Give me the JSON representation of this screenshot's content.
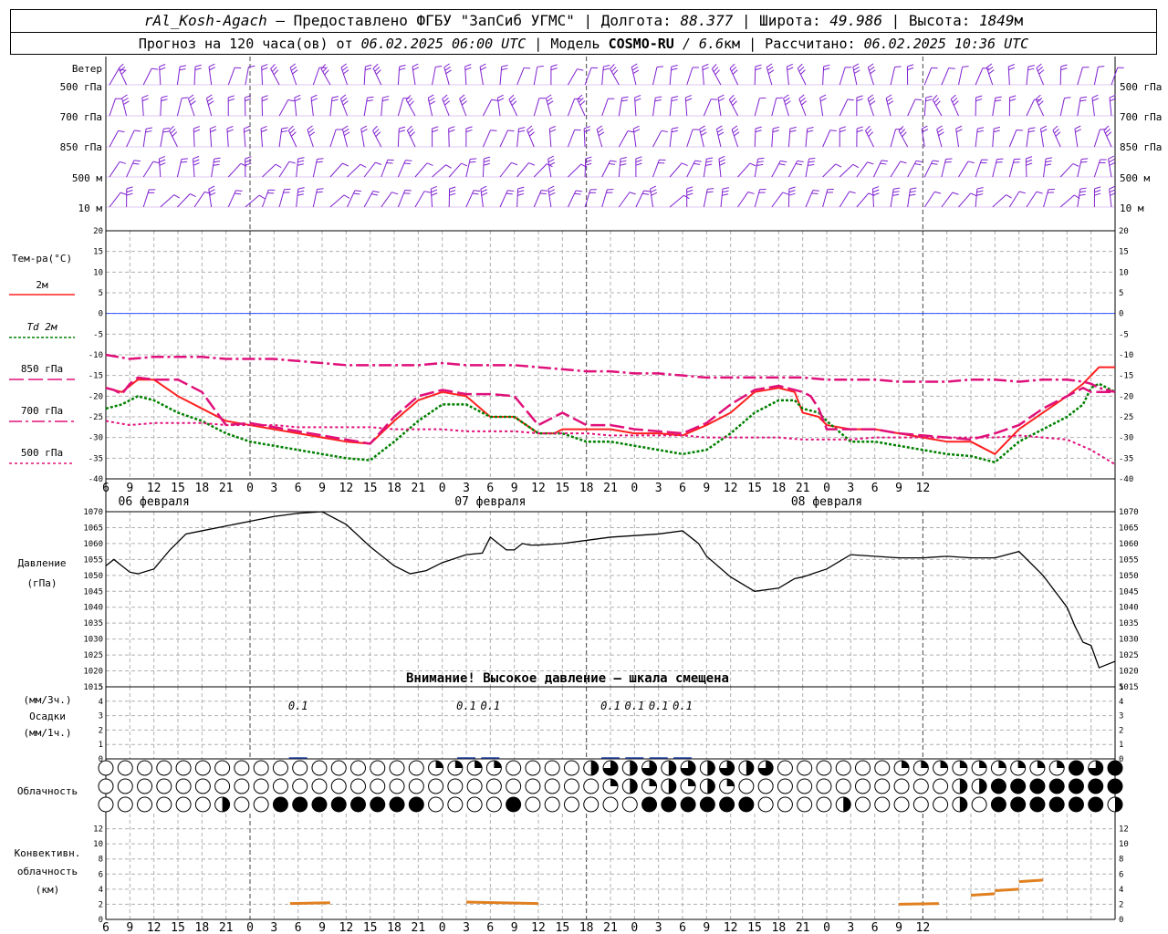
{
  "header": {
    "station": "rAl_Kosh-Agach",
    "provider_text": " – Предоставлено ФГБУ \"ЗапСиб УГМС\" | Долгота: ",
    "lon": "88.377",
    "lat_label": " | Широта: ",
    "lat": "49.986",
    "alt_label": " | Высота: ",
    "alt": "1849",
    "alt_unit": "м",
    "forecast_text": "Прогноз на 120 часа(ов) от ",
    "forecast_time": "06.02.2025 06:00 UTC",
    "model_label": "  | Модель ",
    "model": "COSMO-RU",
    "res": " / 6.6",
    "res_unit": "км",
    "calc_label": " | Рассчитано: ",
    "calc_time": "06.02.2025 10:36 UTC"
  },
  "panels": {
    "wind_title": "Ветер",
    "wind_levels": [
      "500 гПа",
      "700 гПа",
      "850 гПа",
      "500 м",
      "10  м"
    ],
    "temp_title": "Тем-ра(°C)",
    "temp_legend": [
      "2м",
      "Td  2м",
      "850 гПа",
      "700 гПа",
      "500 гПа"
    ],
    "pres_title_1": "Давление",
    "pres_title_2": "(гПа)",
    "pres_warning": "Внимание! Высокое давление – шкала смещена",
    "precip_title_1": "(мм/3ч.)",
    "precip_title_2": "Осадки",
    "precip_title_3": "(мм/1ч.)",
    "cloud_title": "Облачность",
    "conv_title_1": "Конвективн.",
    "conv_title_2": "облачность",
    "conv_title_3": "(км)"
  },
  "colors": {
    "t2m": "#ff2020",
    "td2m": "#008000",
    "t850": "#e0107a",
    "t700": "#e0107a",
    "t500": "#e0107a",
    "pressure": "#000000",
    "zero_line": "#3050ff",
    "wind": "#8020d0",
    "conv": "#e08020",
    "precip": "#2040a0"
  },
  "chart_data": [
    {
      "type": "line",
      "name": "temperature",
      "x_hours_from_start": [
        0,
        3,
        6,
        9,
        12,
        15,
        18,
        21,
        24,
        27,
        30,
        33,
        36,
        39,
        42,
        45,
        48,
        51,
        54,
        57,
        60,
        63,
        66,
        69,
        72,
        75,
        78,
        81,
        84,
        87,
        90,
        93,
        96,
        99,
        102,
        105,
        108,
        111,
        114,
        117,
        120,
        123,
        126
      ],
      "x_tick_labels": [
        "6",
        "9",
        "12",
        "15",
        "18",
        "21",
        "0",
        "3",
        "6",
        "9",
        "12",
        "15",
        "18",
        "21",
        "0",
        "3",
        "6",
        "9",
        "12",
        "15",
        "18",
        "21",
        "0",
        "3",
        "6",
        "9",
        "12",
        "15",
        "18",
        "21",
        "0",
        "3",
        "6",
        "9",
        "12"
      ],
      "date_labels": [
        "06 февраля",
        "07 февраля",
        "08 февраля"
      ],
      "ylim": [
        -40,
        20
      ],
      "y_ticks": [
        20,
        15,
        10,
        5,
        0,
        -5,
        -10,
        -15,
        -20,
        -25,
        -30,
        -35,
        -40
      ],
      "series": [
        {
          "name": "2м",
          "x": [
            0,
            2,
            4,
            6,
            9,
            12,
            15,
            18,
            21,
            24,
            27,
            30,
            33,
            36,
            39,
            42,
            45,
            48,
            51,
            54,
            56,
            57,
            60,
            63,
            66,
            69,
            72,
            75,
            78,
            81,
            84,
            86,
            87,
            89,
            90,
            93,
            96,
            99,
            102,
            105,
            108,
            111,
            114,
            117,
            120,
            122,
            123,
            124,
            126
          ],
          "values": [
            -18,
            -19,
            -16,
            -16,
            -20,
            -23,
            -26,
            -27,
            -28,
            -29,
            -30,
            -31,
            -31.5,
            -26,
            -21,
            -19,
            -20,
            -25,
            -25,
            -29,
            -29,
            -28,
            -28,
            -28,
            -29,
            -29,
            -29.5,
            -27,
            -24,
            -19,
            -18,
            -19,
            -24,
            -25,
            -27,
            -28,
            -28,
            -29,
            -30,
            -31,
            -31,
            -34,
            -28,
            -24,
            -20,
            -17,
            -15,
            -13,
            -13
          ]
        },
        {
          "name": "Td  2м",
          "x": [
            0,
            2,
            4,
            6,
            9,
            12,
            15,
            18,
            21,
            24,
            27,
            30,
            33,
            36,
            39,
            42,
            45,
            48,
            51,
            54,
            56,
            57,
            60,
            63,
            66,
            69,
            72,
            75,
            78,
            81,
            84,
            86,
            87,
            89,
            90,
            93,
            96,
            99,
            102,
            105,
            108,
            111,
            114,
            117,
            120,
            122,
            123,
            124,
            126
          ],
          "values": [
            -23,
            -22,
            -20,
            -21,
            -24,
            -26,
            -29,
            -31,
            -32,
            -33,
            -34,
            -35,
            -35.5,
            -31,
            -26,
            -22,
            -22,
            -25,
            -25,
            -29,
            -29,
            -29,
            -31,
            -31,
            -32,
            -33,
            -34,
            -33,
            -29,
            -24,
            -21,
            -21,
            -23,
            -24,
            -26,
            -31,
            -31,
            -32,
            -33,
            -34,
            -34.5,
            -36,
            -31,
            -28,
            -25,
            -22,
            -18,
            -17,
            -19
          ]
        },
        {
          "name": "850 гПа",
          "x": [
            0,
            1,
            2,
            3,
            4,
            6,
            9,
            12,
            15,
            18,
            21,
            24,
            27,
            30,
            33,
            36,
            39,
            42,
            45,
            48,
            51,
            54,
            57,
            60,
            63,
            66,
            69,
            72,
            75,
            78,
            81,
            84,
            87,
            88,
            89,
            90,
            93,
            96,
            99,
            102,
            105,
            108,
            111,
            114,
            117,
            120,
            122,
            123,
            124,
            126
          ],
          "values": [
            -18,
            -18.5,
            -19.5,
            -17,
            -15.5,
            -16,
            -16,
            -19,
            -27,
            -26.5,
            -27.5,
            -28.5,
            -29.5,
            -30.5,
            -31.5,
            -25,
            -20,
            -18.5,
            -19.5,
            -19.5,
            -20,
            -27,
            -24,
            -27,
            -27,
            -28,
            -28.5,
            -29,
            -26.5,
            -22,
            -18.5,
            -17.5,
            -19,
            -20,
            -23,
            -28,
            -28,
            -28,
            -29,
            -29.5,
            -30,
            -30.5,
            -29,
            -27,
            -23,
            -20,
            -18,
            -19,
            -19,
            -19
          ]
        },
        {
          "name": "700 гПа",
          "x": [
            0,
            3,
            6,
            9,
            12,
            15,
            18,
            21,
            24,
            27,
            30,
            33,
            36,
            39,
            42,
            45,
            48,
            51,
            54,
            57,
            60,
            63,
            66,
            69,
            72,
            75,
            78,
            81,
            84,
            87,
            90,
            93,
            96,
            99,
            102,
            105,
            108,
            111,
            114,
            117,
            120,
            122,
            123,
            124,
            126
          ],
          "values": [
            -10,
            -11,
            -10.5,
            -10.5,
            -10.5,
            -11,
            -11,
            -11,
            -11.5,
            -12,
            -12.5,
            -12.5,
            -12.5,
            -12.5,
            -12,
            -12.5,
            -12.5,
            -12.5,
            -13,
            -13.5,
            -14,
            -14,
            -14.5,
            -14.5,
            -15,
            -15.5,
            -15.5,
            -15.5,
            -15.5,
            -15.5,
            -16,
            -16,
            -16,
            -16.5,
            -16.5,
            -16.5,
            -16,
            -16,
            -16.5,
            -16,
            -16,
            -16.5,
            -17,
            -18,
            -19
          ]
        },
        {
          "name": "500 гПа",
          "x": [
            0,
            3,
            6,
            9,
            12,
            15,
            18,
            21,
            24,
            27,
            30,
            33,
            36,
            39,
            42,
            45,
            48,
            51,
            54,
            57,
            60,
            63,
            66,
            69,
            72,
            75,
            78,
            81,
            84,
            87,
            90,
            93,
            96,
            99,
            102,
            105,
            108,
            111,
            114,
            117,
            120,
            123,
            126
          ],
          "values": [
            -26,
            -27,
            -26.5,
            -26.5,
            -26.5,
            -27,
            -27,
            -27,
            -27.5,
            -27.5,
            -27.5,
            -27.5,
            -28,
            -28,
            -28,
            -28.5,
            -28.5,
            -28.5,
            -29,
            -29,
            -29,
            -29.5,
            -29.5,
            -29.5,
            -29.5,
            -30,
            -30,
            -30,
            -30,
            -30.5,
            -30.5,
            -30.5,
            -30,
            -30,
            -30,
            -30,
            -30,
            -30,
            -29.5,
            -30,
            -30.5,
            -33,
            -36.5
          ]
        }
      ]
    },
    {
      "type": "line",
      "name": "pressure",
      "x_hours_from_start": [
        0,
        1,
        2,
        3,
        4,
        6,
        8,
        10,
        12,
        15,
        18,
        21,
        24,
        27,
        30,
        33,
        35,
        36,
        38,
        40,
        42,
        45,
        47,
        48,
        50,
        51,
        52,
        53,
        54,
        57,
        60,
        63,
        66,
        69,
        72,
        74,
        75,
        78,
        81,
        84,
        86,
        87,
        90,
        93,
        96,
        99,
        102,
        105,
        108,
        111,
        114,
        117,
        120,
        121,
        122,
        123,
        124,
        126
      ],
      "values": [
        1053,
        1055,
        1053,
        1051,
        1050.5,
        1052,
        1058,
        1063,
        1064,
        1065.5,
        1067,
        1068.5,
        1069.5,
        1070,
        1066,
        1059,
        1055,
        1053,
        1050.5,
        1051.5,
        1054,
        1056.5,
        1057,
        1062,
        1058,
        1058,
        1060,
        1059.5,
        1059.5,
        1060,
        1061,
        1062,
        1062.5,
        1063,
        1064,
        1060,
        1056,
        1049.5,
        1045,
        1046,
        1049,
        1049.5,
        1052,
        1056.5,
        1056,
        1055.5,
        1055.5,
        1056,
        1055.5,
        1055.5,
        1057.5,
        1050,
        1040,
        1034,
        1029,
        1028,
        1021,
        1023
      ],
      "ylim": [
        1015,
        1070
      ],
      "y_ticks": [
        1070,
        1065,
        1060,
        1055,
        1050,
        1045,
        1040,
        1035,
        1030,
        1025,
        1020,
        1015
      ]
    },
    {
      "type": "bar",
      "name": "precipitation",
      "ylim": [
        0,
        5
      ],
      "y_ticks": [
        5,
        4,
        3,
        2,
        1,
        0
      ],
      "labels": [
        {
          "x": 24,
          "text": "0.1"
        },
        {
          "x": 45,
          "text": "0.1"
        },
        {
          "x": 48,
          "text": "0.1"
        },
        {
          "x": 63,
          "text": "0.1"
        },
        {
          "x": 66,
          "text": "0.1"
        },
        {
          "x": 69,
          "text": "0.1"
        },
        {
          "x": 72,
          "text": "0.1"
        }
      ]
    },
    {
      "type": "line",
      "name": "convective_cloud",
      "ylim": [
        0,
        14
      ],
      "y_ticks": [
        12,
        10,
        8,
        6,
        4,
        2,
        0
      ],
      "segments": [
        {
          "x": [
            23,
            28
          ],
          "values": [
            2.1,
            2.2
          ]
        },
        {
          "x": [
            45,
            54
          ],
          "values": [
            2.3,
            2.1
          ]
        },
        {
          "x": [
            99,
            104
          ],
          "values": [
            2.0,
            2.1
          ]
        },
        {
          "x": [
            108,
            111
          ],
          "values": [
            3.2,
            3.4
          ]
        },
        {
          "x": [
            111,
            114
          ],
          "values": [
            3.8,
            4.0
          ]
        },
        {
          "x": [
            114,
            117
          ],
          "values": [
            5.0,
            5.2
          ]
        }
      ]
    }
  ]
}
